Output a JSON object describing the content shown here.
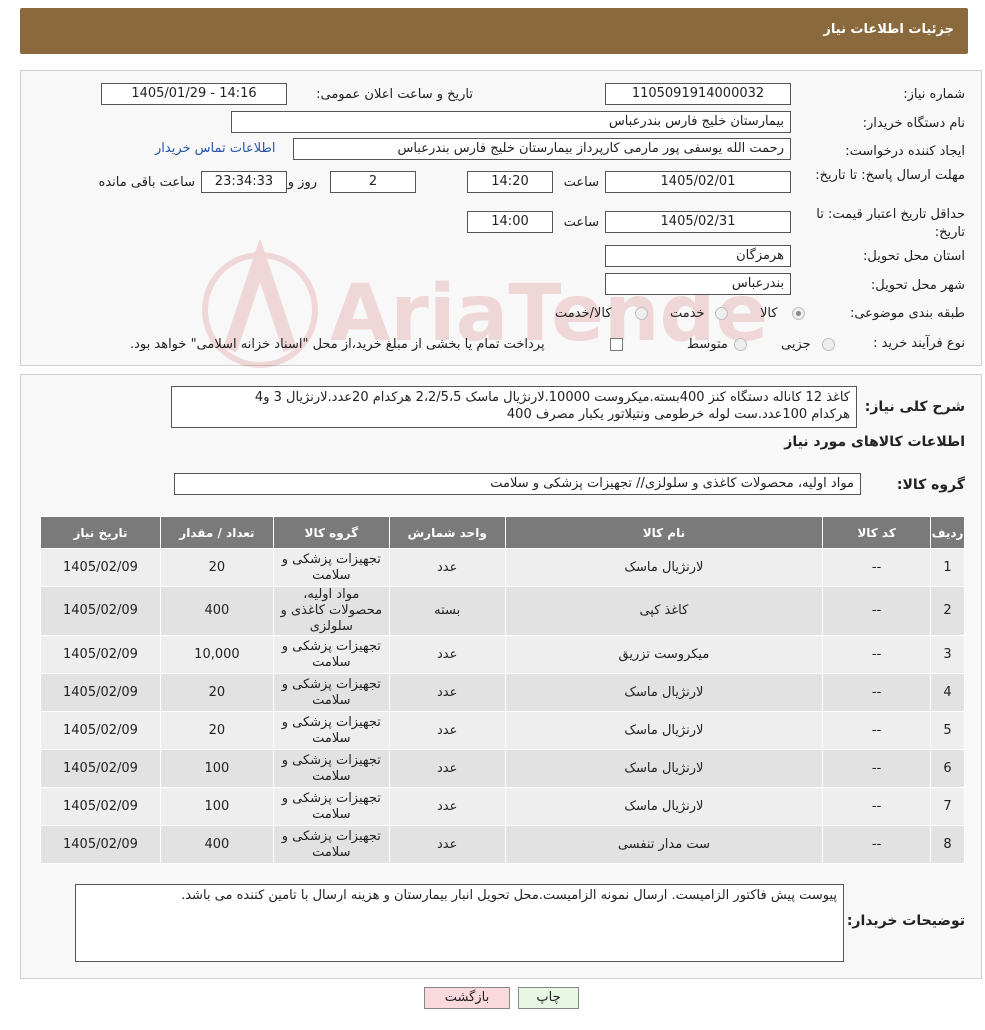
{
  "page_title": "جزئیات اطلاعات نیاز",
  "fields": {
    "need_number_label": "شماره نیاز:",
    "need_number": "1105091914000032",
    "announce_label": "تاریخ و ساعت اعلان عمومی:",
    "announce_value": "1405/01/29 - 14:16",
    "buyer_org_label": "نام دستگاه خریدار:",
    "buyer_org": "بیمارستان خلیج فارس بندرعباس",
    "creator_label": "ایجاد کننده درخواست:",
    "creator": "رحمت الله یوسفی پور مارمی کارپرداز بیمارستان خلیج فارس بندرعباس",
    "contact_link": "اطلاعات تماس خریدار",
    "deadline_label": "مهلت ارسال پاسخ: تا تاریخ:",
    "deadline_date": "1405/02/01",
    "time_label": "ساعت",
    "deadline_time": "14:20",
    "days_value": "2",
    "days_label": "روز و",
    "remaining_time": "23:34:33",
    "remaining_label": "ساعت باقی مانده",
    "validity_label": "حداقل تاریخ اعتبار قیمت: تا تاریخ:",
    "validity_date": "1405/02/31",
    "validity_time": "14:00",
    "province_label": "استان محل تحویل:",
    "province": "هرمزگان",
    "city_label": "شهر محل تحویل:",
    "city": "بندرعباس",
    "category_label": "طبقه بندی موضوعی:",
    "category_options": [
      "کالا",
      "خدمت",
      "کالا/خدمت"
    ],
    "process_label": "نوع فرآیند خرید :",
    "process_options": [
      "جزیی",
      "متوسط"
    ],
    "process_note": "پرداخت تمام یا بخشی از مبلغ خرید،از محل \"اسناد خزانه اسلامی\" خواهد بود."
  },
  "summary": {
    "label": "شرح کلی نیاز:",
    "line1": "کاغذ 12 کاناله دستگاه کنز 400بسته.میکروست 10000.لارنژیال ماسک 2،2/5،5 هرکدام 20عدد.لارنژیال 3 و4",
    "line2": "هرکدام 100عدد.ست لوله خرطومی ونتیلاتور یکبار مصرف 400"
  },
  "goods_section_title": "اطلاعات کالاهای مورد نیاز",
  "goods_group_label": "گروه کالا:",
  "goods_group_value": "مواد اولیه، محصولات کاغذی و سلولزی// تجهیزات پزشکی و سلامت",
  "table": {
    "headers": [
      "ردیف",
      "کد کالا",
      "نام کالا",
      "واحد شمارش",
      "گروه کالا",
      "تعداد / مقدار",
      "تاریخ نیاز"
    ],
    "rows": [
      [
        "1",
        "--",
        "لارنژیال ماسک",
        "عدد",
        "تجهیزات پزشکی و سلامت",
        "20",
        "1405/02/09"
      ],
      [
        "2",
        "--",
        "کاغذ کپی",
        "بسته",
        "مواد اولیه، محصولات کاغذی و سلولزی",
        "400",
        "1405/02/09"
      ],
      [
        "3",
        "--",
        "میکروست تزریق",
        "عدد",
        "تجهیزات پزشکی و سلامت",
        "10,000",
        "1405/02/09"
      ],
      [
        "4",
        "--",
        "لارنژیال ماسک",
        "عدد",
        "تجهیزات پزشکی و سلامت",
        "20",
        "1405/02/09"
      ],
      [
        "5",
        "--",
        "لارنژیال ماسک",
        "عدد",
        "تجهیزات پزشکی و سلامت",
        "20",
        "1405/02/09"
      ],
      [
        "6",
        "--",
        "لارنژیال ماسک",
        "عدد",
        "تجهیزات پزشکی و سلامت",
        "100",
        "1405/02/09"
      ],
      [
        "7",
        "--",
        "لارنژیال ماسک",
        "عدد",
        "تجهیزات پزشکی و سلامت",
        "100",
        "1405/02/09"
      ],
      [
        "8",
        "--",
        "ست مدار تنفسی",
        "عدد",
        "تجهیزات پزشکی و سلامت",
        "400",
        "1405/02/09"
      ]
    ]
  },
  "buyer_notes_label": "توضیحات خریدار:",
  "buyer_notes": "پیوست پیش فاکتور الزامیست. ارسال نمونه الزامیست.محل تحویل انبار بیمارستان و هزینه ارسال با تامین کننده می باشد.",
  "buttons": {
    "print": "چاپ",
    "back": "بازگشت"
  },
  "watermark_text": "AriaTender.neT",
  "colors": {
    "header": "#8a6a3d",
    "table_header": "#7a7a7a",
    "link": "#2456a8",
    "back_button": "#f9d9dc",
    "print_button": "#e8f7e3"
  }
}
